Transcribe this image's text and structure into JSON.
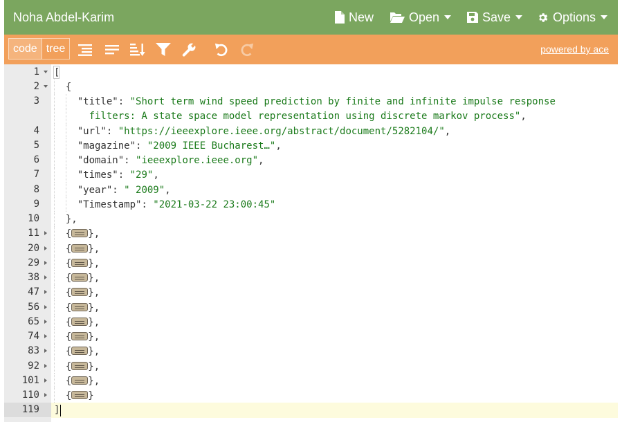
{
  "header": {
    "title": "Noha Abdel-Karim",
    "new_label": "New",
    "open_label": "Open",
    "save_label": "Save",
    "options_label": "Options",
    "bg_color": "#7ba65f"
  },
  "toolbar": {
    "modes": [
      "code",
      "tree"
    ],
    "active_mode": "code",
    "tools": [
      "format-icon",
      "compact-icon",
      "sort-icon",
      "filter-icon",
      "repair-icon",
      "undo-icon",
      "redo-icon"
    ],
    "powered_label": "powered by ace",
    "bg_color": "#f2a05b"
  },
  "editor": {
    "active_line": "119",
    "lines": [
      {
        "num": "1",
        "fold": "open",
        "indent": 0,
        "segments": [
          {
            "t": "p",
            "v": "["
          }
        ]
      },
      {
        "num": "2",
        "fold": "open",
        "indent": 1,
        "segments": [
          {
            "t": "p",
            "v": "{"
          }
        ]
      },
      {
        "num": "3",
        "fold": "",
        "indent": 2,
        "segments": [
          {
            "t": "k",
            "v": "\"title\""
          },
          {
            "t": "p",
            "v": ": "
          },
          {
            "t": "s",
            "v": "\"Short term wind speed prediction by finite and infinite impulse response"
          }
        ]
      },
      {
        "num": "",
        "fold": "",
        "indent": 3,
        "continuation": true,
        "segments": [
          {
            "t": "s",
            "v": "filters: A state space model representation using discrete markov process\""
          },
          {
            "t": "p",
            "v": ","
          }
        ]
      },
      {
        "num": "4",
        "fold": "",
        "indent": 2,
        "segments": [
          {
            "t": "k",
            "v": "\"url\""
          },
          {
            "t": "p",
            "v": ": "
          },
          {
            "t": "s",
            "v": "\"https://ieeexplore.ieee.org/abstract/document/5282104/\""
          },
          {
            "t": "p",
            "v": ","
          }
        ]
      },
      {
        "num": "5",
        "fold": "",
        "indent": 2,
        "segments": [
          {
            "t": "k",
            "v": "\"magazine\""
          },
          {
            "t": "p",
            "v": ": "
          },
          {
            "t": "s",
            "v": "\"2009 IEEE Bucharest…\""
          },
          {
            "t": "p",
            "v": ","
          }
        ]
      },
      {
        "num": "6",
        "fold": "",
        "indent": 2,
        "segments": [
          {
            "t": "k",
            "v": "\"domain\""
          },
          {
            "t": "p",
            "v": ": "
          },
          {
            "t": "s",
            "v": "\"ieeexplore.ieee.org\""
          },
          {
            "t": "p",
            "v": ","
          }
        ]
      },
      {
        "num": "7",
        "fold": "",
        "indent": 2,
        "segments": [
          {
            "t": "k",
            "v": "\"times\""
          },
          {
            "t": "p",
            "v": ": "
          },
          {
            "t": "s",
            "v": "\"29\""
          },
          {
            "t": "p",
            "v": ","
          }
        ]
      },
      {
        "num": "8",
        "fold": "",
        "indent": 2,
        "segments": [
          {
            "t": "k",
            "v": "\"year\""
          },
          {
            "t": "p",
            "v": ": "
          },
          {
            "t": "s",
            "v": "\" 2009\""
          },
          {
            "t": "p",
            "v": ","
          }
        ]
      },
      {
        "num": "9",
        "fold": "",
        "indent": 2,
        "segments": [
          {
            "t": "k",
            "v": "\"Timestamp\""
          },
          {
            "t": "p",
            "v": ": "
          },
          {
            "t": "s",
            "v": "\"2021-03-22 23:00:45\""
          }
        ]
      },
      {
        "num": "10",
        "fold": "",
        "indent": 1,
        "segments": [
          {
            "t": "p",
            "v": "},"
          }
        ]
      },
      {
        "num": "11",
        "fold": "closed",
        "indent": 1,
        "collapsed": true
      },
      {
        "num": "20",
        "fold": "closed",
        "indent": 1,
        "collapsed": true
      },
      {
        "num": "29",
        "fold": "closed",
        "indent": 1,
        "collapsed": true
      },
      {
        "num": "38",
        "fold": "closed",
        "indent": 1,
        "collapsed": true
      },
      {
        "num": "47",
        "fold": "closed",
        "indent": 1,
        "collapsed": true
      },
      {
        "num": "56",
        "fold": "closed",
        "indent": 1,
        "collapsed": true
      },
      {
        "num": "65",
        "fold": "closed",
        "indent": 1,
        "collapsed": true
      },
      {
        "num": "74",
        "fold": "closed",
        "indent": 1,
        "collapsed": true
      },
      {
        "num": "83",
        "fold": "closed",
        "indent": 1,
        "collapsed": true
      },
      {
        "num": "92",
        "fold": "closed",
        "indent": 1,
        "collapsed": true
      },
      {
        "num": "101",
        "fold": "closed",
        "indent": 1,
        "collapsed": true
      },
      {
        "num": "110",
        "fold": "closed",
        "indent": 1,
        "collapsed": true,
        "last": true
      },
      {
        "num": "119",
        "fold": "",
        "indent": 0,
        "segments": [
          {
            "t": "p",
            "v": "]"
          }
        ]
      }
    ]
  }
}
